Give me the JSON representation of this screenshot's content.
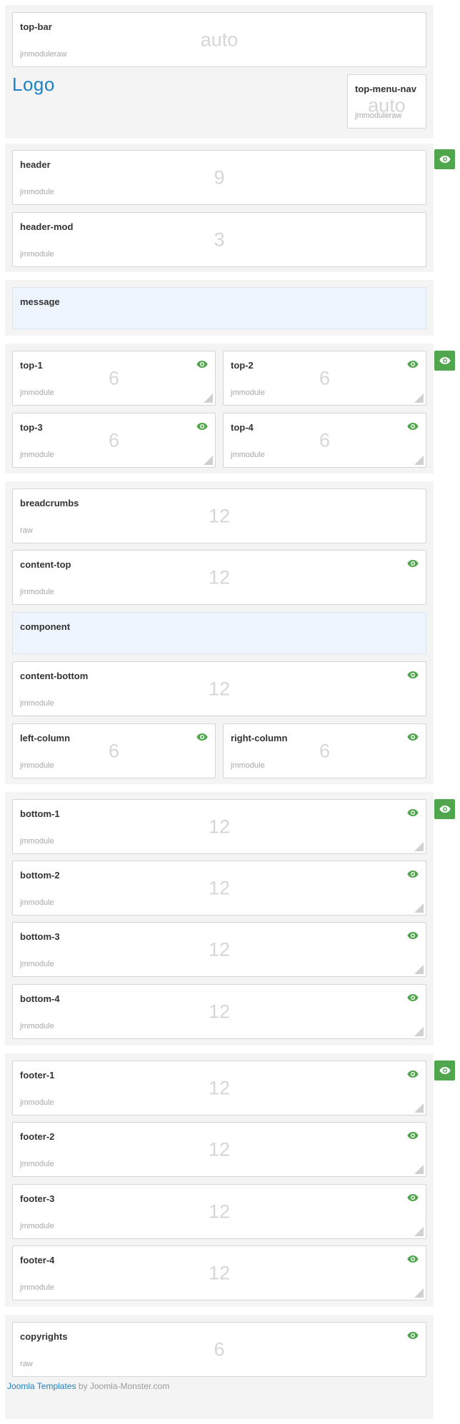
{
  "top_bar": {
    "name": "top-bar",
    "style": "jmmoduleraw",
    "width": "auto"
  },
  "logo": {
    "text": "Logo"
  },
  "top_menu_nav": {
    "name": "top-menu-nav",
    "style": "jmmoduleraw",
    "width": "auto"
  },
  "header": {
    "name": "header",
    "style": "jmmodule",
    "width": "9"
  },
  "header_mod": {
    "name": "header-mod",
    "style": "jmmodule",
    "width": "3"
  },
  "message": {
    "name": "message"
  },
  "top_1": {
    "name": "top-1",
    "style": "jmmodule",
    "width": "6"
  },
  "top_2": {
    "name": "top-2",
    "style": "jmmodule",
    "width": "6"
  },
  "top_3": {
    "name": "top-3",
    "style": "jmmodule",
    "width": "6"
  },
  "top_4": {
    "name": "top-4",
    "style": "jmmodule",
    "width": "6"
  },
  "breadcrumbs": {
    "name": "breadcrumbs",
    "style": "raw",
    "width": "12"
  },
  "content_top": {
    "name": "content-top",
    "style": "jmmodule",
    "width": "12"
  },
  "component": {
    "name": "component"
  },
  "content_bottom": {
    "name": "content-bottom",
    "style": "jmmodule",
    "width": "12"
  },
  "left_column": {
    "name": "left-column",
    "style": "jmmodule",
    "width": "6"
  },
  "right_column": {
    "name": "right-column",
    "style": "jmmodule",
    "width": "6"
  },
  "bottom_1": {
    "name": "bottom-1",
    "style": "jmmodule",
    "width": "12"
  },
  "bottom_2": {
    "name": "bottom-2",
    "style": "jmmodule",
    "width": "12"
  },
  "bottom_3": {
    "name": "bottom-3",
    "style": "jmmodule",
    "width": "12"
  },
  "bottom_4": {
    "name": "bottom-4",
    "style": "jmmodule",
    "width": "12"
  },
  "footer_1": {
    "name": "footer-1",
    "style": "jmmodule",
    "width": "12"
  },
  "footer_2": {
    "name": "footer-2",
    "style": "jmmodule",
    "width": "12"
  },
  "footer_3": {
    "name": "footer-3",
    "style": "jmmodule",
    "width": "12"
  },
  "footer_4": {
    "name": "footer-4",
    "style": "jmmodule",
    "width": "12"
  },
  "copyrights": {
    "name": "copyrights",
    "style": "raw",
    "width": "6"
  },
  "footer_credit": {
    "link_text": "Joomla Templates",
    "rest": " by Joomla-Monster.com"
  },
  "icons": {
    "visibility": "eye-icon",
    "resize": "resize-handle-icon"
  },
  "colors": {
    "accent_green": "#50a64d",
    "link_blue": "#1b82c4",
    "component_bg": "#eef5fe"
  }
}
